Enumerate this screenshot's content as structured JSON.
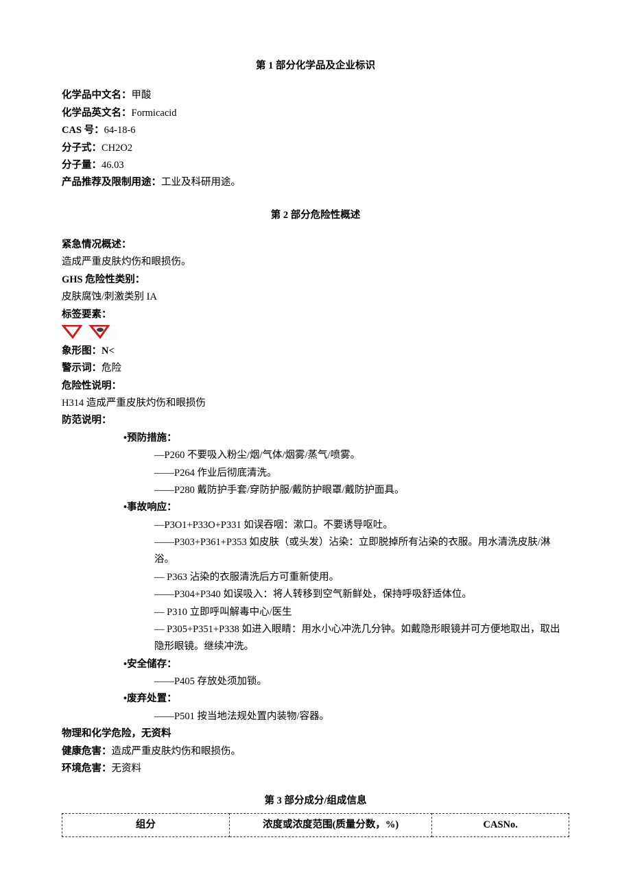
{
  "section1": {
    "title": "第 1 部分化学品及企业标识",
    "name_cn_label": "化学品中文名：",
    "name_cn": "甲酸",
    "name_en_label": "化学品英文名：",
    "name_en": "Formicacid",
    "cas_label": "CAS 号：",
    "cas": "64-18-6",
    "formula_label": "分子式：",
    "formula": "CH2O2",
    "mw_label": "分子量：",
    "mw": "46.03",
    "use_label": "产品推荐及限制用途：",
    "use": "工业及科研用途。"
  },
  "section2": {
    "title": "第 2 部分危险性概述",
    "emergency_label": "紧急情况概述：",
    "emergency": "造成严重皮肤灼伤和眼损伤。",
    "ghs_label": "GHS 危险性类别：",
    "ghs": "皮肤腐蚀/刺激类别 IA",
    "label_elem": "标签要素：",
    "picto_label": "象形图：",
    "picto_val": "N<",
    "signal_label": "警示词：",
    "signal": "危险",
    "hazard_label": "危险性说明：",
    "hazard": "H314 造成严重皮肤灼伤和眼损伤",
    "precaution_label": "防范说明：",
    "prevent_title": "•预防措施：",
    "prevent": [
      "—P260 不要吸入粉尘/烟/气体/烟雾/蒸气/喷雾。",
      "——P264 作业后彻底清洗。",
      "——P280 戴防护手套/穿防护服/戴防护眼罩/戴防护面具。"
    ],
    "response_title": "•事故响应：",
    "response": [
      "—P3O1+P33O+P331 如误吞咽：漱口。不要诱导呕吐。",
      "——P303+P361+P353 如皮肤（或头发）沾染：立即脱掉所有沾染的衣服。用水清洗皮肤/淋浴。",
      "—    P363 沾染的衣服清洗后方可重新使用。",
      "——P304+P340 如误吸入：将人转移到空气新鲜处，保持呼吸舒适体位。",
      "—    P310 立即呼叫解毒中心/医生",
      "—    P305+P351+P338 如进入眼睛：用水小心冲洗几分钟。如戴隐形眼镜并可方便地取出，取出隐形眼镜。继续冲洗。"
    ],
    "storage_title": "•安全储存：",
    "storage": [
      "——P405 存放处须加锁。"
    ],
    "disposal_title": "•废弃处置：",
    "disposal": [
      "——P501 按当地法规处置内装物/容器。"
    ],
    "phys_label": "物理和化学危险，",
    "phys": "无资料",
    "health_label": "健康危害：",
    "health": "造成严重皮肤灼伤和眼损伤。",
    "env_label": "环境危害：",
    "env": "无资料"
  },
  "section3": {
    "title": "第 3 部分成分/组成信息",
    "headers": [
      "组分",
      "浓度或浓度范围(质量分数，%)",
      "CASNo."
    ]
  }
}
